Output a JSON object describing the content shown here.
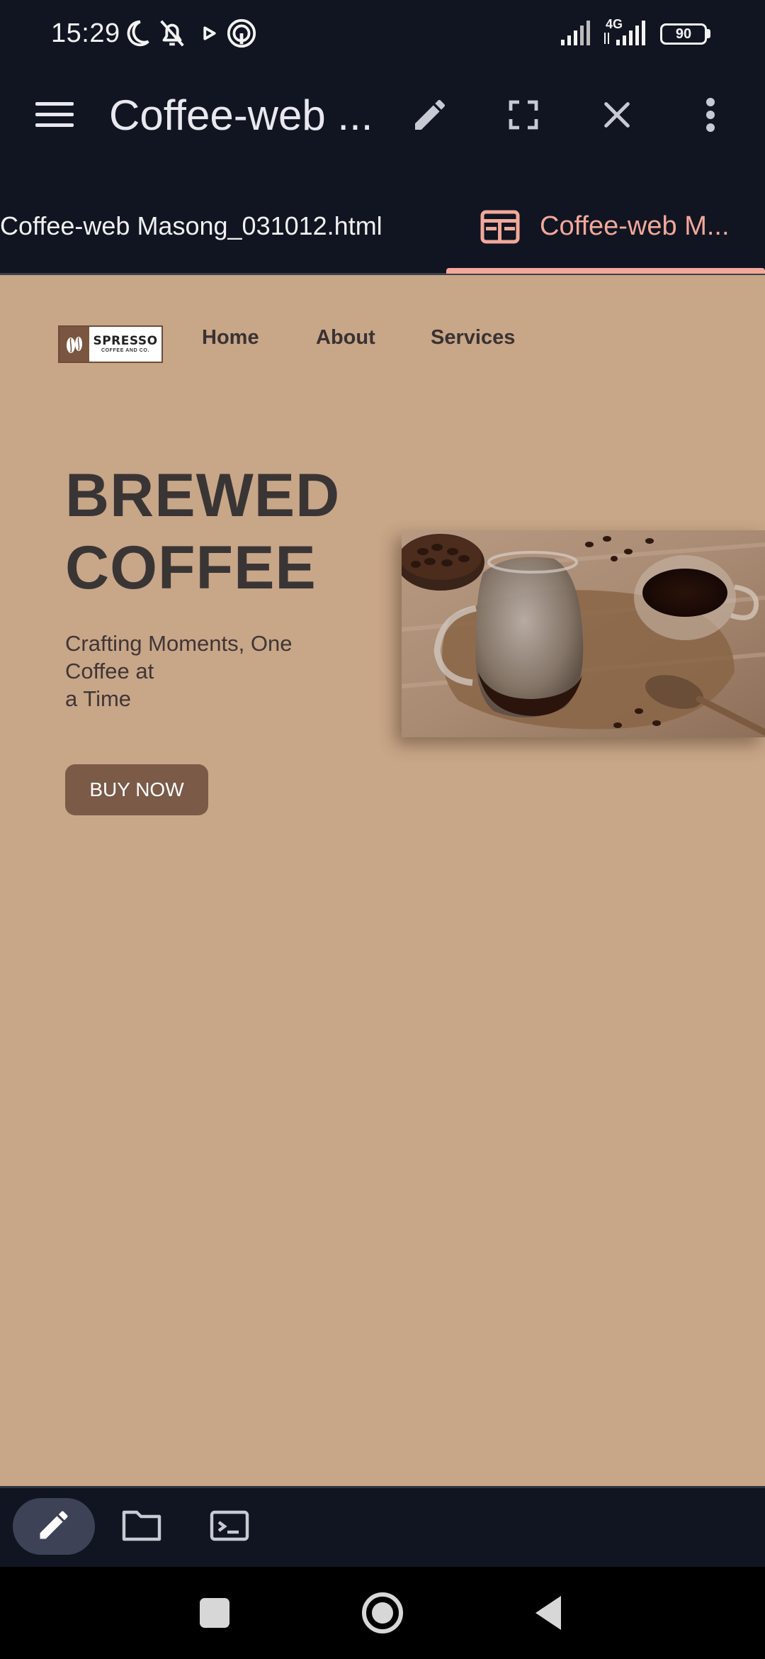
{
  "status_bar": {
    "time": "15:29",
    "network": "4G",
    "battery": "90",
    "icons": [
      "moon-icon",
      "bell-off-icon",
      "play-icon",
      "hotspot-icon",
      "signal-icon",
      "signal-4g-icon",
      "battery-icon"
    ]
  },
  "app_bar": {
    "title": "Coffee-web ...",
    "icons": [
      "menu-icon",
      "pencil-icon",
      "fullscreen-icon",
      "close-icon",
      "more-vert-icon"
    ]
  },
  "tabs": [
    {
      "label": "Coffee-web Masong_031012.html",
      "active": false
    },
    {
      "label": "Coffee-web M...",
      "active": true,
      "icon": "preview-icon"
    }
  ],
  "colors": {
    "chrome_bg": "#111522",
    "accent": "#f2a89a",
    "page_bg": "#c8a688",
    "button_bg": "#7b5a48"
  },
  "website": {
    "logo": {
      "name": "SPRESSO",
      "tagline": "COFFEE AND CO."
    },
    "nav": [
      "Home",
      "About",
      "Services"
    ],
    "hero": {
      "title_line1": "BREWED",
      "title_line2": "COFFEE",
      "subtitle_line1": "Crafting Moments, One",
      "subtitle_line2": "Coffee at",
      "subtitle_line3": "a Time",
      "cta": "BUY NOW"
    }
  },
  "bottom_toolbar": {
    "icons": [
      "edit-icon",
      "folder-icon",
      "terminal-icon"
    ],
    "active": "edit-icon"
  },
  "nav_bar": {
    "icons": [
      "recents-icon",
      "home-icon",
      "back-icon"
    ]
  }
}
